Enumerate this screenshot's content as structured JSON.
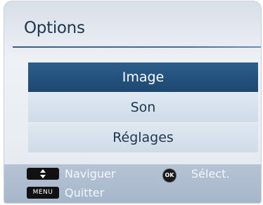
{
  "title": "Options",
  "menu": {
    "items": [
      {
        "label": "Image",
        "selected": true
      },
      {
        "label": "Son",
        "selected": false
      },
      {
        "label": "Réglages",
        "selected": false
      }
    ]
  },
  "footer": {
    "navigate_label": "Naviguer",
    "ok_key": "OK",
    "select_label": "Sélect.",
    "menu_key": "MENU",
    "quit_label": "Quitter"
  },
  "colors": {
    "selected_bg": "#23517d",
    "item_bg": "#d8e2ee",
    "text": "#1f3550",
    "footer_bg": "#aebdd0"
  },
  "icons": {
    "navigate_key": "up-down-arrows-icon",
    "ok_key": "ok-button-icon"
  }
}
